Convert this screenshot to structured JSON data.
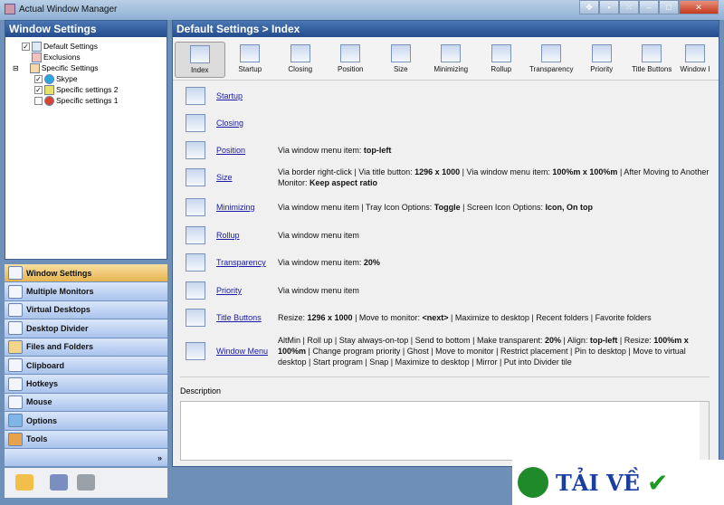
{
  "app_title": "Actual Window Manager",
  "left_header": "Window Settings",
  "tree": [
    {
      "label": "Default Settings",
      "checked": true
    },
    {
      "label": "Exclusions"
    },
    {
      "label": "Specific Settings"
    },
    {
      "label": "Skype",
      "checked": true
    },
    {
      "label": "Specific settings 2",
      "checked": true
    },
    {
      "label": "Specific settings 1",
      "checked": false
    }
  ],
  "nav": [
    "Window Settings",
    "Multiple Monitors",
    "Virtual Desktops",
    "Desktop Divider",
    "Files and Folders",
    "Clipboard",
    "Hotkeys",
    "Mouse",
    "Options",
    "Tools"
  ],
  "nav_more": "»",
  "right_header": "Default Settings > Index",
  "toolbar": [
    "Index",
    "Startup",
    "Closing",
    "Position",
    "Size",
    "Minimizing",
    "Rollup",
    "Transparency",
    "Priority",
    "Title Buttons",
    "Window I"
  ],
  "rows": [
    {
      "link": "Startup",
      "desc": ""
    },
    {
      "link": "Closing",
      "desc": ""
    },
    {
      "link": "Position",
      "desc": "Via window menu item: <b>top-left</b>"
    },
    {
      "link": "Size",
      "desc": "Via border right-click | Via title button: <b>1296 x 1000</b> | Via window menu item: <b>100%m x 100%m</b> | After Moving to Another Monitor: <b>Keep aspect ratio</b>"
    },
    {
      "link": "Minimizing",
      "desc": "Via window menu item | Tray Icon Options: <b>Toggle</b> | Screen Icon Options: <b>Icon, On top</b>"
    },
    {
      "link": "Rollup",
      "desc": "Via window menu item"
    },
    {
      "link": "Transparency",
      "desc": "Via window menu item: <b>20%</b>"
    },
    {
      "link": "Priority",
      "desc": "Via window menu item"
    },
    {
      "link": "Title Buttons",
      "desc": "Resize: <b>1296 x 1000</b> | Move to monitor: <b>&lt;next&gt;</b> | Maximize to desktop | Recent folders | Favorite folders"
    },
    {
      "link": "Window Menu",
      "desc": "AltMin | Roll up | Stay always-on-top | Send to bottom | Make transparent: <b>20%</b> | Align: <b>top-left</b> | Resize: <b>100%m x 100%m</b> | Change program priority | Ghost | Move to monitor | Restrict placement | Pin to desktop | Move to virtual desktop | Start program | Snap | Maximize to desktop | Mirror | Put into Divider tile"
    }
  ],
  "description_label": "Description",
  "description_value": "",
  "watermark": "TẢI VỀ"
}
